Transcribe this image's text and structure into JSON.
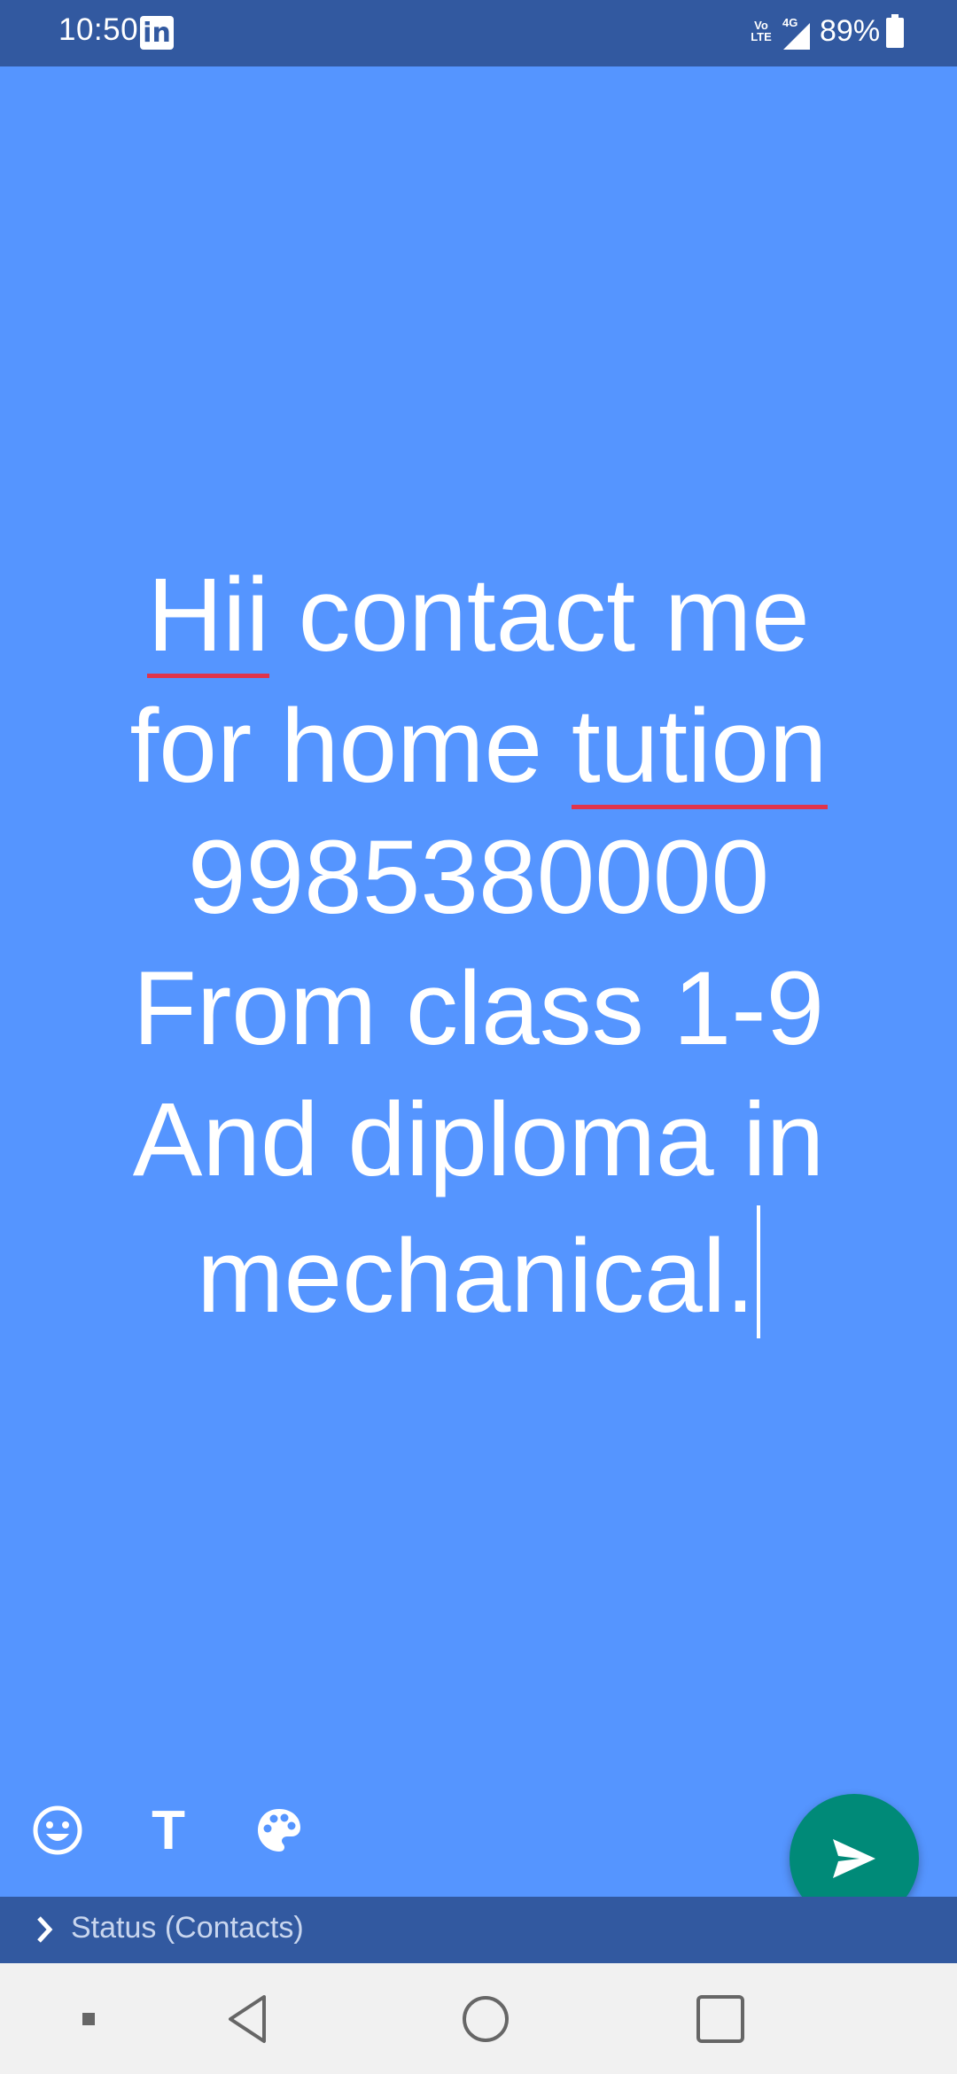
{
  "status_bar": {
    "time": "10:50",
    "app_notification_icon": "linkedin-icon",
    "app_notification_letter": "in",
    "volte_label": "Vo\nLTE",
    "network_type": "4G",
    "battery_percent": "89%"
  },
  "status_text": {
    "lines": [
      {
        "before": "",
        "misspelled": "Hii",
        "after": " contact me"
      },
      {
        "before": "for home ",
        "misspelled": "tution",
        "after": ""
      },
      {
        "before": "9985380000",
        "misspelled": "",
        "after": ""
      },
      {
        "before": "From class 1-9 ",
        "misspelled": "",
        "after": ""
      },
      {
        "before": "And diploma in",
        "misspelled": "",
        "after": ""
      },
      {
        "before": "mechanical.",
        "misspelled": "",
        "after": ""
      }
    ]
  },
  "colors": {
    "background": "#5595FF",
    "bar": "#3259A0",
    "send_button": "#008A78",
    "spell_underline": "#E0344B"
  },
  "tools": {
    "emoji": "emoji-icon",
    "text": "T",
    "palette": "palette-icon"
  },
  "send": {
    "icon": "send-icon"
  },
  "audience": {
    "icon": "chevron-right-icon",
    "label": "Status (Contacts)"
  },
  "nav": {
    "items": [
      "menu-dot-icon",
      "back-icon",
      "home-icon",
      "recents-icon"
    ]
  }
}
